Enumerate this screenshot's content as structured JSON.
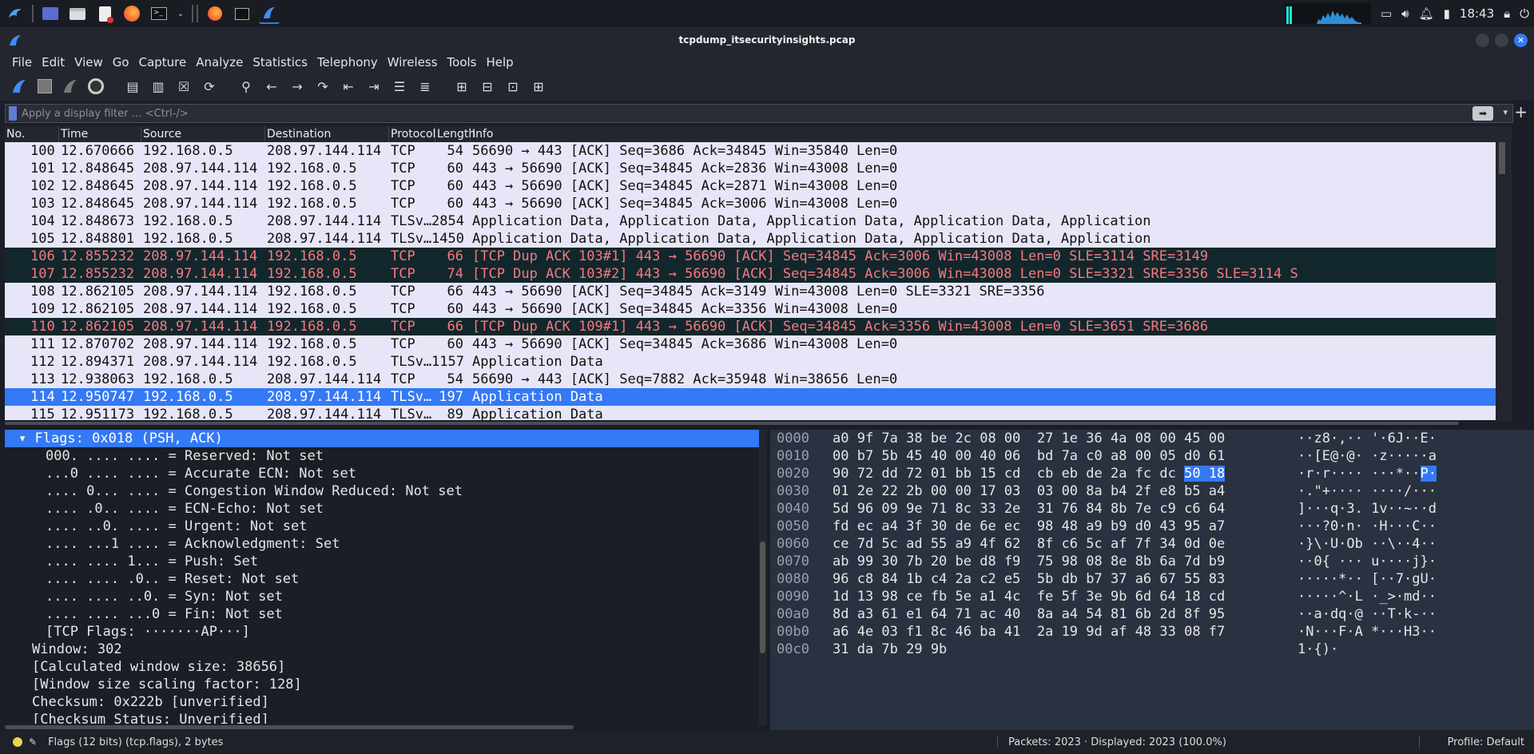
{
  "taskbar": {
    "clock": "18:43"
  },
  "window": {
    "title": "tcpdump_itsecurityinsights.pcap"
  },
  "menu": [
    "File",
    "Edit",
    "View",
    "Go",
    "Capture",
    "Analyze",
    "Statistics",
    "Telephony",
    "Wireless",
    "Tools",
    "Help"
  ],
  "filter": {
    "placeholder": "Apply a display filter … <Ctrl-/>"
  },
  "packet_list": {
    "columns": [
      "No.",
      "Time",
      "Source",
      "Destination",
      "Protocol",
      "Length",
      "Info"
    ],
    "rows": [
      {
        "no": "100",
        "time": "12.670666",
        "src": "192.168.0.5",
        "dst": "208.97.144.114",
        "proto": "TCP",
        "len": "54",
        "info": "56690 → 443 [ACK] Seq=3686 Ack=34845 Win=35840 Len=0",
        "style": "tcp"
      },
      {
        "no": "101",
        "time": "12.848645",
        "src": "208.97.144.114",
        "dst": "192.168.0.5",
        "proto": "TCP",
        "len": "60",
        "info": "443 → 56690 [ACK] Seq=34845 Ack=2836 Win=43008 Len=0",
        "style": "tcp"
      },
      {
        "no": "102",
        "time": "12.848645",
        "src": "208.97.144.114",
        "dst": "192.168.0.5",
        "proto": "TCP",
        "len": "60",
        "info": "443 → 56690 [ACK] Seq=34845 Ack=2871 Win=43008 Len=0",
        "style": "tcp"
      },
      {
        "no": "103",
        "time": "12.848645",
        "src": "208.97.144.114",
        "dst": "192.168.0.5",
        "proto": "TCP",
        "len": "60",
        "info": "443 → 56690 [ACK] Seq=34845 Ack=3006 Win=43008 Len=0",
        "style": "tcp"
      },
      {
        "no": "104",
        "time": "12.848673",
        "src": "192.168.0.5",
        "dst": "208.97.144.114",
        "proto": "TLSv…",
        "len": "2854",
        "info": "Application Data, Application Data, Application Data, Application Data, Application",
        "style": "tcp"
      },
      {
        "no": "105",
        "time": "12.848801",
        "src": "192.168.0.5",
        "dst": "208.97.144.114",
        "proto": "TLSv…",
        "len": "1450",
        "info": "Application Data, Application Data, Application Data, Application Data, Application",
        "style": "tcp"
      },
      {
        "no": "106",
        "time": "12.855232",
        "src": "208.97.144.114",
        "dst": "192.168.0.5",
        "proto": "TCP",
        "len": "66",
        "info": "[TCP Dup ACK 103#1] 443 → 56690 [ACK] Seq=34845 Ack=3006 Win=43008 Len=0 SLE=3114 SRE=3149",
        "style": "bad"
      },
      {
        "no": "107",
        "time": "12.855232",
        "src": "208.97.144.114",
        "dst": "192.168.0.5",
        "proto": "TCP",
        "len": "74",
        "info": "[TCP Dup ACK 103#2] 443 → 56690 [ACK] Seq=34845 Ack=3006 Win=43008 Len=0 SLE=3321 SRE=3356 SLE=3114 S",
        "style": "bad"
      },
      {
        "no": "108",
        "time": "12.862105",
        "src": "208.97.144.114",
        "dst": "192.168.0.5",
        "proto": "TCP",
        "len": "66",
        "info": "443 → 56690 [ACK] Seq=34845 Ack=3149 Win=43008 Len=0 SLE=3321 SRE=3356",
        "style": "tcp"
      },
      {
        "no": "109",
        "time": "12.862105",
        "src": "208.97.144.114",
        "dst": "192.168.0.5",
        "proto": "TCP",
        "len": "60",
        "info": "443 → 56690 [ACK] Seq=34845 Ack=3356 Win=43008 Len=0",
        "style": "tcp"
      },
      {
        "no": "110",
        "time": "12.862105",
        "src": "208.97.144.114",
        "dst": "192.168.0.5",
        "proto": "TCP",
        "len": "66",
        "info": "[TCP Dup ACK 109#1] 443 → 56690 [ACK] Seq=34845 Ack=3356 Win=43008 Len=0 SLE=3651 SRE=3686",
        "style": "bad"
      },
      {
        "no": "111",
        "time": "12.870702",
        "src": "208.97.144.114",
        "dst": "192.168.0.5",
        "proto": "TCP",
        "len": "60",
        "info": "443 → 56690 [ACK] Seq=34845 Ack=3686 Win=43008 Len=0",
        "style": "tcp"
      },
      {
        "no": "112",
        "time": "12.894371",
        "src": "208.97.144.114",
        "dst": "192.168.0.5",
        "proto": "TLSv…",
        "len": "1157",
        "info": "Application Data",
        "style": "tcp"
      },
      {
        "no": "113",
        "time": "12.938063",
        "src": "192.168.0.5",
        "dst": "208.97.144.114",
        "proto": "TCP",
        "len": "54",
        "info": "56690 → 443 [ACK] Seq=7882 Ack=35948 Win=38656 Len=0",
        "style": "tcp"
      },
      {
        "no": "114",
        "time": "12.950747",
        "src": "192.168.0.5",
        "dst": "208.97.144.114",
        "proto": "TLSv…",
        "len": "197",
        "info": "Application Data",
        "style": "sel"
      },
      {
        "no": "115",
        "time": "12.951173",
        "src": "192.168.0.5",
        "dst": "208.97.144.114",
        "proto": "TLSv…",
        "len": "89",
        "info": "Application Data",
        "style": "tcp"
      }
    ]
  },
  "details": [
    {
      "text": "▾ Flags: 0x018 (PSH, ACK)",
      "indent": 2,
      "selected": true
    },
    {
      "text": "000. .... .... = Reserved: Not set",
      "indent": 6
    },
    {
      "text": "...0 .... .... = Accurate ECN: Not set",
      "indent": 6
    },
    {
      "text": ".... 0... .... = Congestion Window Reduced: Not set",
      "indent": 6
    },
    {
      "text": ".... .0.. .... = ECN-Echo: Not set",
      "indent": 6
    },
    {
      "text": ".... ..0. .... = Urgent: Not set",
      "indent": 6
    },
    {
      "text": ".... ...1 .... = Acknowledgment: Set",
      "indent": 6
    },
    {
      "text": ".... .... 1... = Push: Set",
      "indent": 6
    },
    {
      "text": ".... .... .0.. = Reset: Not set",
      "indent": 6
    },
    {
      "text": ".... .... ..0. = Syn: Not set",
      "indent": 6
    },
    {
      "text": ".... .... ...0 = Fin: Not set",
      "indent": 6
    },
    {
      "text": "[TCP Flags: ·······AP···]",
      "indent": 6
    },
    {
      "text": "Window: 302",
      "indent": 4
    },
    {
      "text": "[Calculated window size: 38656]",
      "indent": 4
    },
    {
      "text": "[Window size scaling factor: 128]",
      "indent": 4
    },
    {
      "text": "Checksum: 0x222b [unverified]",
      "indent": 4
    },
    {
      "text": "[Checksum Status: Unverified]",
      "indent": 4
    }
  ],
  "hex": [
    {
      "off": "0000",
      "hex": "a0 9f 7a 38 be 2c 08 00  27 1e 36 4a 08 00 45 00",
      "ascii": "··z8·,·· '·6J··E·"
    },
    {
      "off": "0010",
      "hex": "00 b7 5b 45 40 00 40 06  bd 7a c0 a8 00 05 d0 61",
      "ascii": "··[E@·@· ·z·····a"
    },
    {
      "off": "0020",
      "hex": "90 72 dd 72 01 bb 15 cd  cb eb de 2a fc dc ",
      "hexhl": "50 18",
      "ascii": "·r·r···· ···*··",
      "aschl": "P·"
    },
    {
      "off": "0030",
      "hex": "01 2e 22 2b 00 00 17 03  03 00 8a b4 2f e8 b5 a4",
      "ascii": "·.\"+···· ····/···"
    },
    {
      "off": "0040",
      "hex": "5d 96 09 9e 71 8c 33 2e  31 76 84 8b 7e c9 c6 64",
      "ascii": "]···q·3. 1v··~··d"
    },
    {
      "off": "0050",
      "hex": "fd ec a4 3f 30 de 6e ec  98 48 a9 b9 d0 43 95 a7",
      "ascii": "···?0·n· ·H···C··"
    },
    {
      "off": "0060",
      "hex": "ce 7d 5c ad 55 a9 4f 62  8f c6 5c af 7f 34 0d 0e",
      "ascii": "·}\\·U·Ob ··\\··4··"
    },
    {
      "off": "0070",
      "hex": "ab 99 30 7b 20 be d8 f9  75 98 08 8e 8b 6a 7d b9",
      "ascii": "··0{ ··· u····j}·"
    },
    {
      "off": "0080",
      "hex": "96 c8 84 1b c4 2a c2 e5  5b db b7 37 a6 67 55 83",
      "ascii": "·····*·· [··7·gU·"
    },
    {
      "off": "0090",
      "hex": "1d 13 98 ce fb 5e a1 4c  fe 5f 3e 9b 6d 64 18 cd",
      "ascii": "·····^·L ·_>·md··"
    },
    {
      "off": "00a0",
      "hex": "8d a3 61 e1 64 71 ac 40  8a a4 54 81 6b 2d 8f 95",
      "ascii": "··a·dq·@ ··T·k-··"
    },
    {
      "off": "00b0",
      "hex": "a6 4e 03 f1 8c 46 ba 41  2a 19 9d af 48 33 08 f7",
      "ascii": "·N···F·A *···H3··"
    },
    {
      "off": "00c0",
      "hex": "31 da 7b 29 9b",
      "ascii": "1·{)·"
    }
  ],
  "status": {
    "field": "Flags (12 bits) (tcp.flags), 2 bytes",
    "packets": "Packets: 2023 · Displayed: 2023 (100.0%)",
    "profile": "Profile: Default"
  },
  "colors": {
    "selected": "#3479f5",
    "bad_bg": "#12272c",
    "bad_fg": "#f7787f",
    "tcp_bg": "#e6e6f8"
  }
}
